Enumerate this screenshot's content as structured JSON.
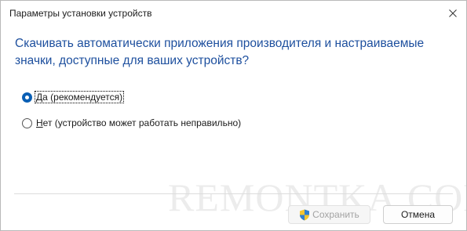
{
  "window": {
    "title": "Параметры установки устройств",
    "close_icon": "close-icon"
  },
  "question": {
    "line1": "Скачивать автоматически приложения производителя и настраиваемые",
    "line2": "значки, доступные для ваших устройств?"
  },
  "options": [
    {
      "mnemonic": "Д",
      "label_rest": "а (рекомендуется)",
      "selected": true
    },
    {
      "mnemonic": "Н",
      "label_rest": "ет (устройство может работать неправильно)",
      "selected": false
    }
  ],
  "buttons": {
    "save": {
      "label": "Сохранить",
      "enabled": false,
      "icon": "shield-icon"
    },
    "cancel": {
      "label": "Отмена",
      "enabled": true
    }
  },
  "watermark": "REMONTKA.COM",
  "colors": {
    "heading": "#1d4f9e",
    "radio_accent": "#0a5fb4",
    "disabled_text": "#a3a3a3"
  }
}
